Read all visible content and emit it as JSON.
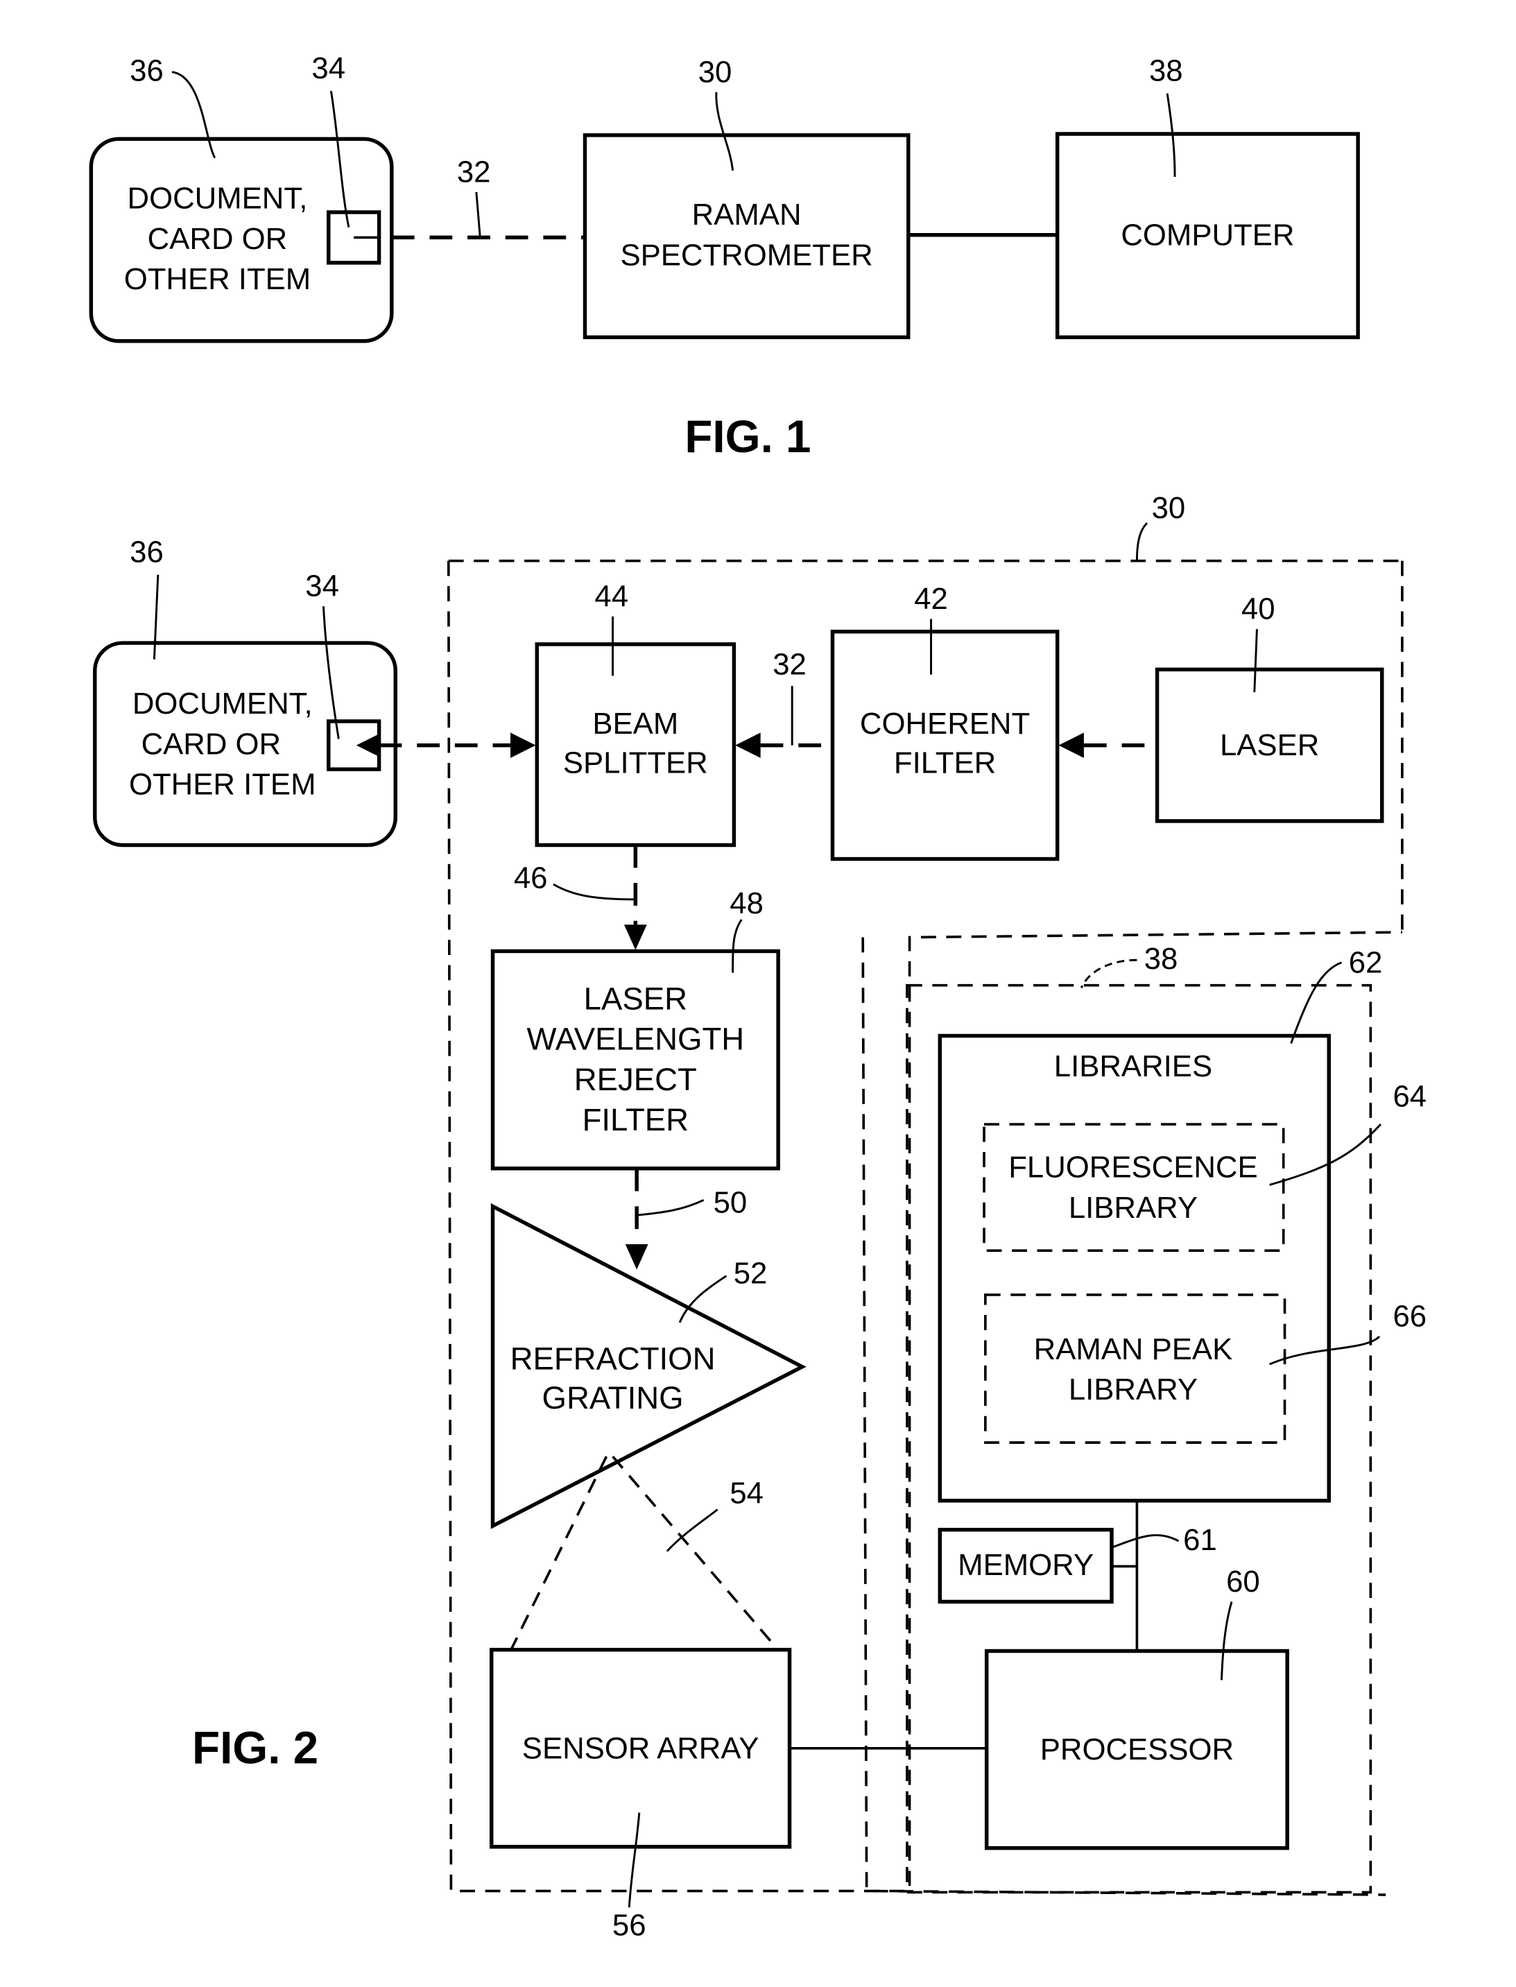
{
  "fig1": {
    "caption": "FIG. 1",
    "item": {
      "lines": [
        "DOCUMENT,",
        "CARD  OR",
        "OTHER ITEM"
      ],
      "ref": "36",
      "spot_ref": "34"
    },
    "beam_ref": "32",
    "spectrometer": {
      "lines": [
        "RAMAN",
        "SPECTROMETER"
      ],
      "ref": "30"
    },
    "computer": {
      "label": "COMPUTER",
      "ref": "38"
    }
  },
  "fig2": {
    "caption": "FIG. 2",
    "spectrometer_ref": "30",
    "item": {
      "lines": [
        "DOCUMENT,",
        "CARD OR",
        "OTHER ITEM"
      ],
      "ref": "36",
      "spot_ref": "34"
    },
    "beam_splitter": {
      "lines": [
        "BEAM",
        "SPLITTER"
      ],
      "ref": "44"
    },
    "beam_ref": "32",
    "coherent_filter": {
      "lines": [
        "COHERENT",
        "FILTER"
      ],
      "ref": "42"
    },
    "laser": {
      "label": "LASER",
      "ref": "40"
    },
    "path_46_ref": "46",
    "reject_filter": {
      "lines": [
        "LASER",
        "WAVELENGTH",
        "REJECT",
        "FILTER"
      ],
      "ref": "48"
    },
    "path_50_ref": "50",
    "grating": {
      "lines": [
        "REFRACTION",
        "GRATING"
      ],
      "ref": "52"
    },
    "dispersion_ref": "54",
    "sensor_array": {
      "label": "SENSOR ARRAY",
      "ref": "56"
    },
    "computer_ref": "38",
    "libraries": {
      "label": "LIBRARIES",
      "ref": "62"
    },
    "fluorescence_library": {
      "lines": [
        "FLUORESCENCE",
        "LIBRARY"
      ],
      "ref": "64"
    },
    "raman_peak_library": {
      "lines": [
        "RAMAN PEAK",
        "LIBRARY"
      ],
      "ref": "66"
    },
    "memory": {
      "label": "MEMORY",
      "ref": "61"
    },
    "processor": {
      "label": "PROCESSOR",
      "ref": "60"
    }
  }
}
